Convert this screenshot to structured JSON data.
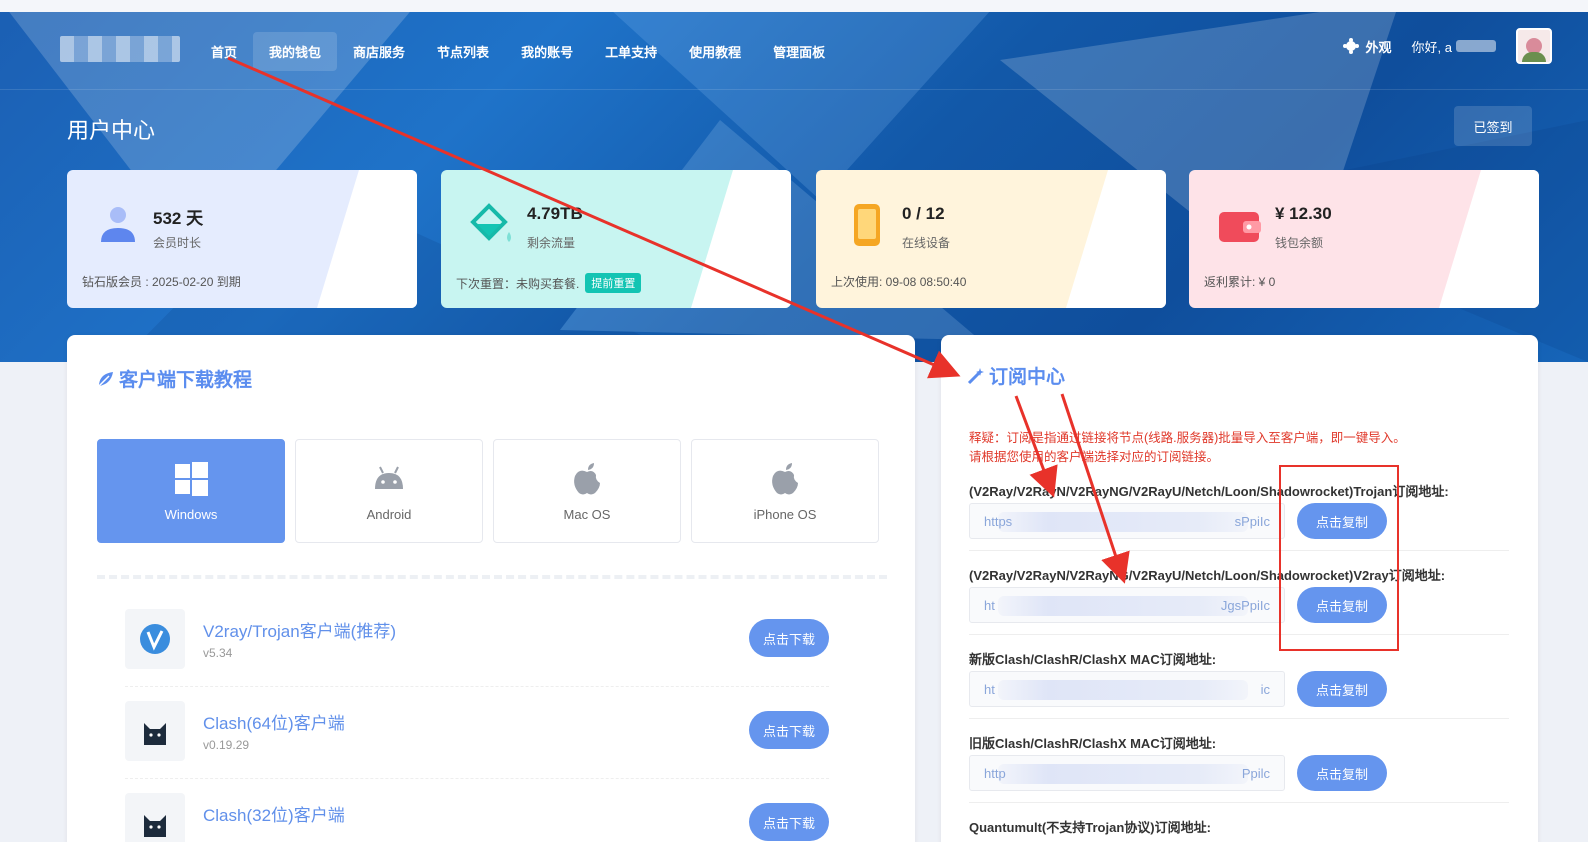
{
  "nav": {
    "items": [
      "首页",
      "我的钱包",
      "商店服务",
      "节点列表",
      "我的账号",
      "工单支持",
      "使用教程",
      "管理面板"
    ],
    "active_index": 1,
    "theme_label": "外观",
    "hello": "你好, a"
  },
  "page": {
    "title": "用户中心",
    "checkin_label": "已签到"
  },
  "stats": [
    {
      "value": "532 天",
      "label": "会员时长",
      "foot": "钻石版会员 : 2025-02-20 到期",
      "icon": "user-icon"
    },
    {
      "value": "4.79TB",
      "label": "剩余流量",
      "foot": "下次重置：未购买套餐.",
      "badge": "提前重置",
      "icon": "bucket-icon"
    },
    {
      "value": "0 / 12",
      "label": "在线设备",
      "foot": "上次使用: 09-08 08:50:40",
      "icon": "phone-icon"
    },
    {
      "value": "¥ 12.30",
      "label": "钱包余额",
      "foot": "返利累计: ¥ 0",
      "icon": "wallet-icon"
    }
  ],
  "download": {
    "title": "客户端下载教程",
    "os_tabs": [
      "Windows",
      "Android",
      "Mac OS",
      "iPhone OS"
    ],
    "active_tab": 0,
    "apps": [
      {
        "name": "V2ray/Trojan客户端(推荐)",
        "version": "v5.34",
        "button": "点击下载"
      },
      {
        "name": "Clash(64位)客户端",
        "version": "v0.19.29",
        "button": "点击下载"
      },
      {
        "name": "Clash(32位)客户端",
        "version": "",
        "button": "点击下载"
      }
    ]
  },
  "subscribe": {
    "title": "订阅中心",
    "notice_line1": "释疑：订阅是指通过链接将节点(线路.服务器)批量导入至客户端，即一键导入。",
    "notice_line2": "请根据您使用的客户端选择对应的订阅链接。",
    "items": [
      {
        "label": "(V2Ray/V2RayN/V2RayNG/V2RayU/Netch/Loon/Shadowrocket)Trojan订阅地址:",
        "prefix": "https",
        "suffix": "sPpiIc",
        "button": "点击复制"
      },
      {
        "label": "(V2Ray/V2RayN/V2RayNG/V2RayU/Netch/Loon/Shadowrocket)V2ray订阅地址:",
        "prefix": "ht",
        "suffix": "JgsPpiIc",
        "button": "点击复制"
      },
      {
        "label": "新版Clash/ClashR/ClashX MAC订阅地址:",
        "prefix": "ht",
        "suffix": "ic",
        "button": "点击复制"
      },
      {
        "label": "旧版Clash/ClashR/ClashX MAC订阅地址:",
        "prefix": "http",
        "suffix": "Ppilc",
        "button": "点击复制"
      },
      {
        "label": "Quantumult(不支持Trojan协议)订阅地址:"
      }
    ]
  },
  "colors": {
    "accent": "#6595ee",
    "danger": "#e8322a",
    "teal": "#13c4b3"
  }
}
